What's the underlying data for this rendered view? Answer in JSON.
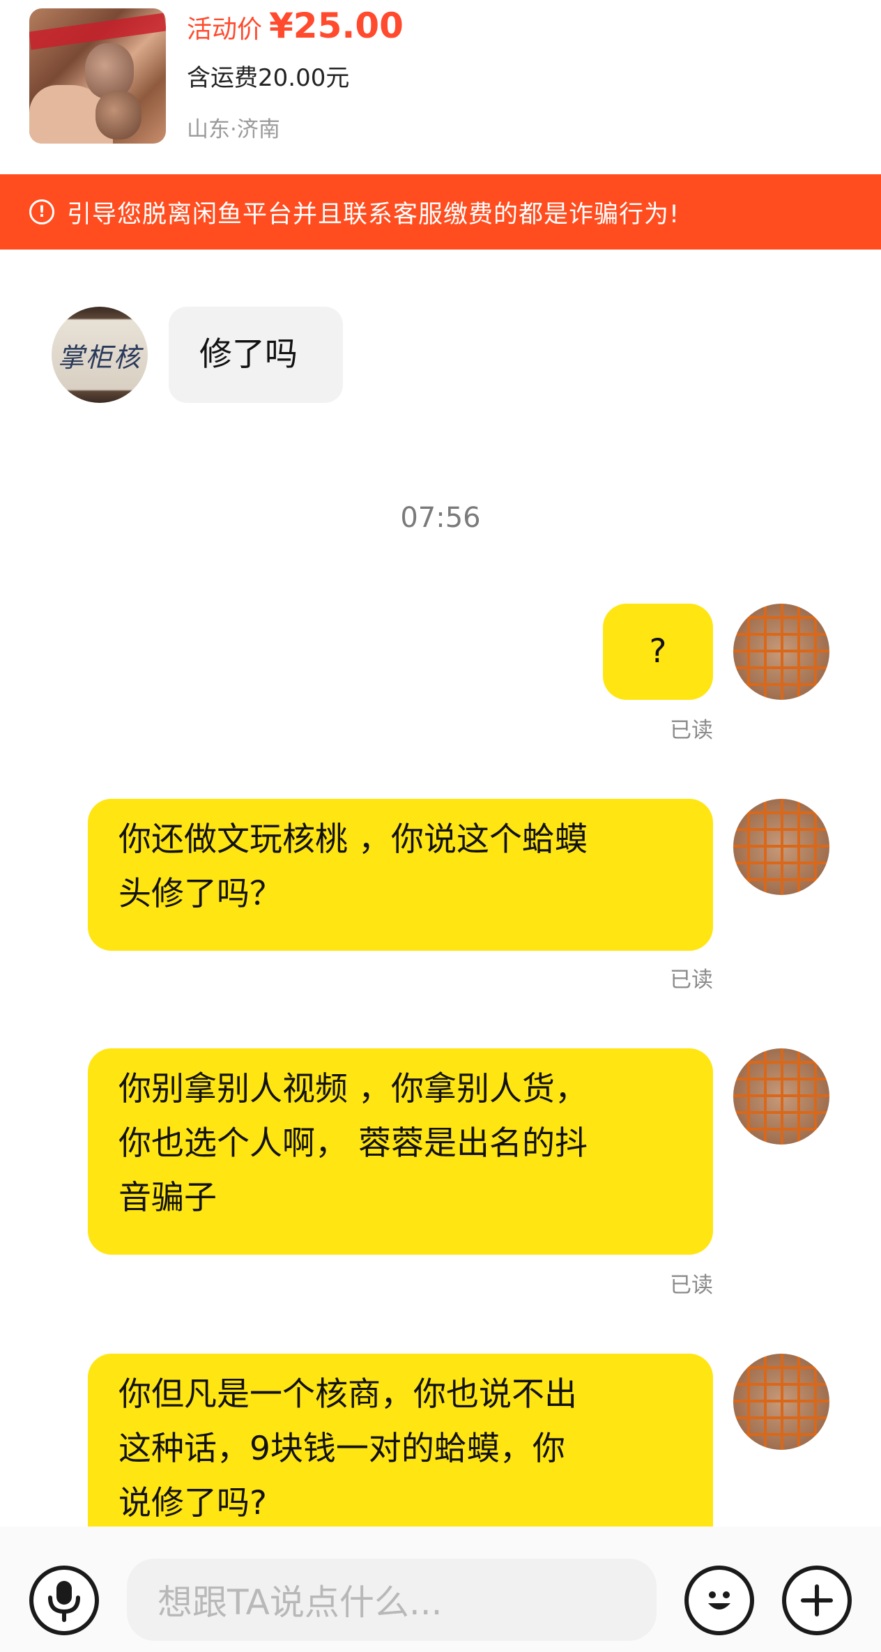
{
  "product": {
    "price_label": "活动价",
    "price": "¥25.00",
    "shipping": "含运费20.00元",
    "location": "山东·济南"
  },
  "warning": {
    "icon": "exclamation-circle-icon",
    "text": "引导您脱离闲鱼平台并且联系客服缴费的都是诈骗行为!"
  },
  "chat": {
    "other_avatar_sign": "掌柜核",
    "messages": [
      {
        "from": "other",
        "lines": [
          "修了吗"
        ]
      },
      {
        "type": "time",
        "text": "07:56"
      },
      {
        "from": "me",
        "lines": [
          "?"
        ],
        "status": "已读"
      },
      {
        "from": "me",
        "lines": [
          "你还做文玩核桃 ，你说这个蛤蟆",
          "头修了吗？"
        ],
        "status": "已读"
      },
      {
        "from": "me",
        "lines": [
          "你别拿别人视频 ，你拿别人货，",
          "你也选个人啊， 蓉蓉是出名的抖",
          "音骗子"
        ],
        "status": "已读"
      },
      {
        "from": "me",
        "lines": [
          "你但凡是一个核商，你也说不出",
          "这种话，9块钱一对的蛤蟆，你",
          "说修了吗?"
        ]
      }
    ]
  },
  "input": {
    "placeholder": "想跟TA说点什么...",
    "voice_icon": "microphone-icon",
    "emoji_icon": "smiley-icon",
    "plus_icon": "plus-icon"
  }
}
